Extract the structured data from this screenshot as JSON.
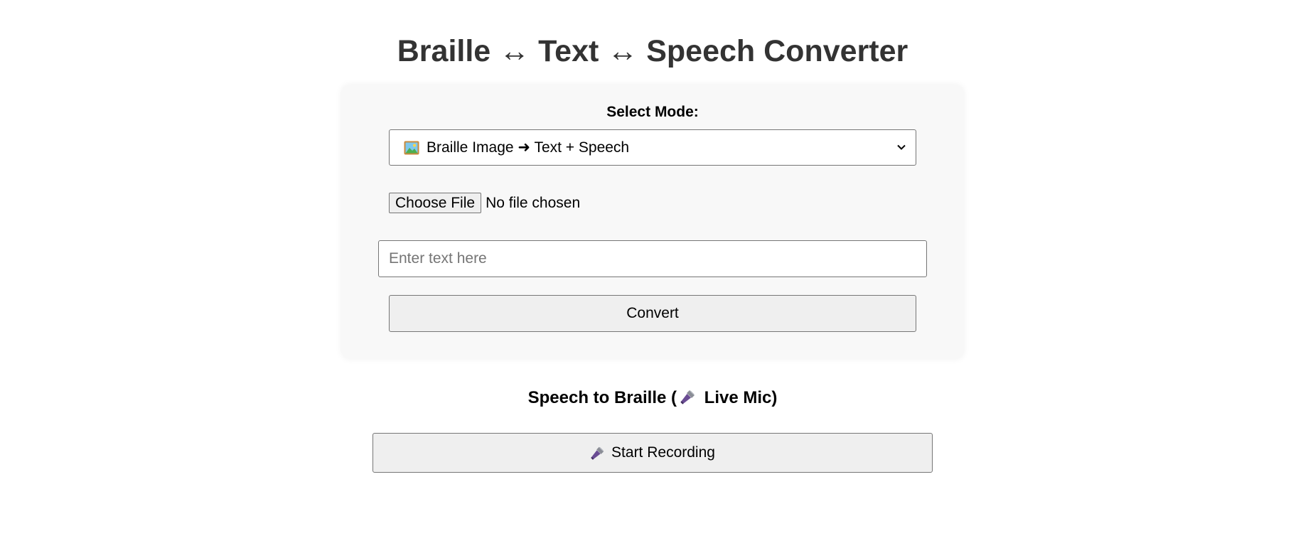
{
  "header": {
    "title": "Braille ↔ Text ↔ Speech Converter"
  },
  "converter": {
    "mode_label": "Select Mode:",
    "mode_selected": "Braille Image ➜ Text + Speech",
    "mode_icon": "picture-icon",
    "file_button_label": "Choose File",
    "file_status": "No file chosen",
    "text_input_placeholder": "Enter text here",
    "text_input_value": "",
    "convert_label": "Convert"
  },
  "speech": {
    "title_prefix": "Speech to Braille (",
    "title_icon": "microphone-icon",
    "title_suffix": " Live Mic)",
    "record_label": "Start Recording",
    "record_icon": "microphone-icon"
  },
  "colors": {
    "title": "#333333",
    "card_background": "#f8f8f8",
    "button_background": "#efefef",
    "border": "#767676"
  }
}
